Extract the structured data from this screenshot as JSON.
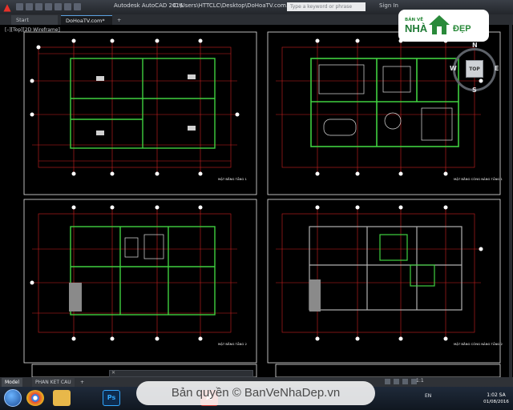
{
  "window": {
    "app_title": "Autodesk AutoCAD 2016",
    "doc_path": "C:\\Users\\HTTCLC\\Desktop\\DoHoaTV.com.dwg",
    "search_placeholder": "Type a keyword or phrase",
    "sign_in": "Sign In"
  },
  "tabs": [
    {
      "label": "Start"
    },
    {
      "label": "DoHoaTV.com*"
    },
    {
      "label": "+"
    }
  ],
  "viewport": {
    "label": "[–][Top][2D Wireframe]",
    "viewcube": {
      "top": "TOP",
      "n": "N",
      "s": "S",
      "w": "W",
      "e": "E"
    }
  },
  "watermark": {
    "logo_line1": "BẢN VẼ",
    "logo_line2": "NHÀ",
    "logo_line3": "ĐẸP",
    "copyright": "Bản quyền © BanVeNhaDep.vn"
  },
  "layout_tabs": [
    {
      "label": "Model"
    },
    {
      "label": "PHAN KET CAU"
    },
    {
      "label": "+"
    }
  ],
  "statusbar": {
    "scale": "1:1"
  },
  "taskbar": {
    "ps_label": "Ps",
    "cad_label": "A",
    "lang": "EN",
    "time": "1:02 SA",
    "date": "01/08/2016"
  },
  "drawing": {
    "sheets": [
      {
        "title": "MẶT BẰNG TẦNG 1"
      },
      {
        "title": "MẶT BẰNG CÔNG NĂNG TẦNG 1"
      },
      {
        "title": "MẶT BẰNG TẦNG 2"
      },
      {
        "title": "MẶT BẰNG CÔNG NĂNG TẦNG 2"
      }
    ]
  }
}
